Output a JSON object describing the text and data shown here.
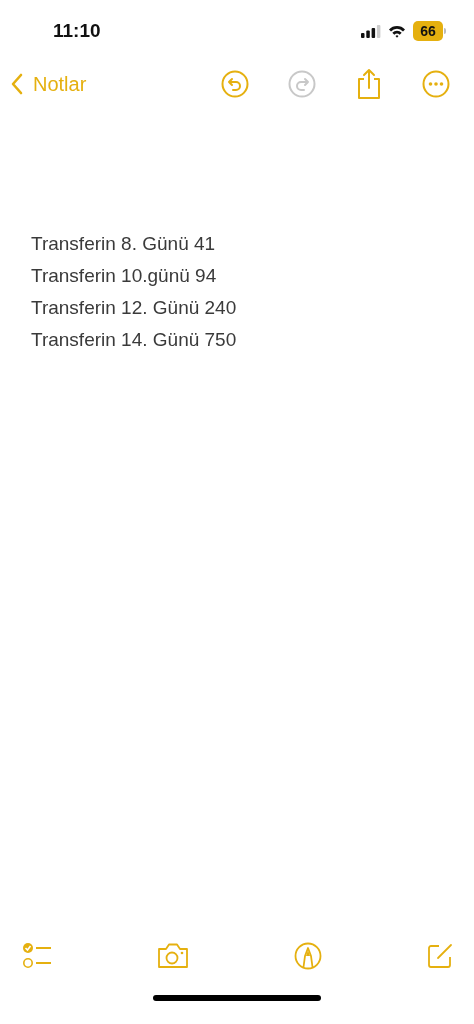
{
  "status_bar": {
    "time": "11:10",
    "battery": "66"
  },
  "nav": {
    "back_label": "Notlar",
    "actions": [
      {
        "kind": "undo",
        "disabled": false
      },
      {
        "kind": "redo",
        "disabled": true
      },
      {
        "kind": "share",
        "disabled": false
      },
      {
        "kind": "more",
        "disabled": false
      }
    ]
  },
  "note": {
    "lines": [
      "Transferin 8. Günü 41",
      "Transferin 10.günü 94",
      "Transferin 12. Günü 240",
      "Transferin 14. Günü 750"
    ]
  },
  "toolbar": [
    {
      "kind": "checklist"
    },
    {
      "kind": "camera"
    },
    {
      "kind": "markup"
    },
    {
      "kind": "compose"
    }
  ]
}
